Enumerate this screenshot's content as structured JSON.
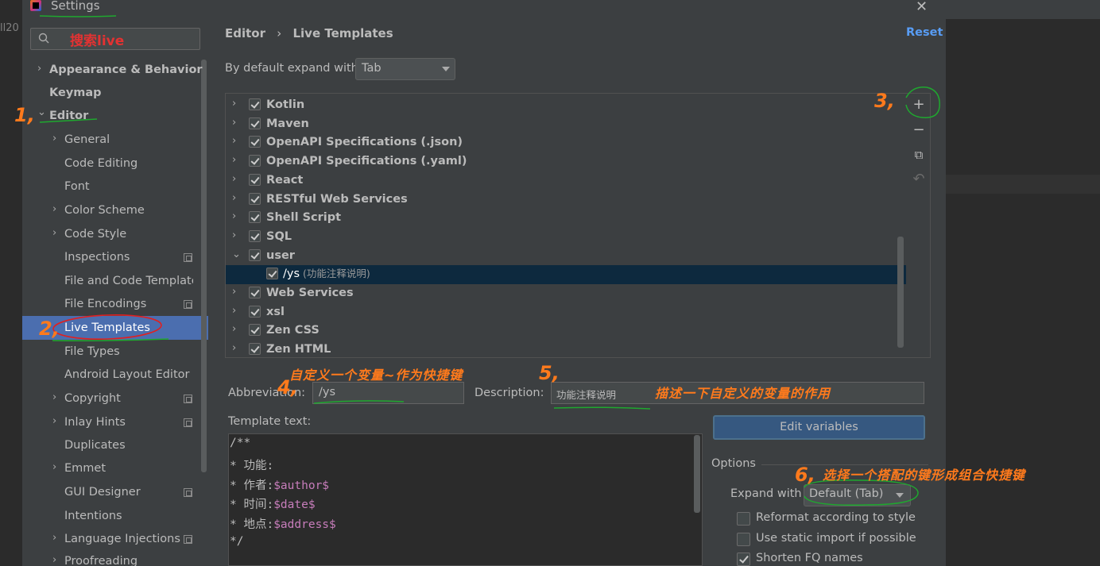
{
  "window": {
    "title": "Settings",
    "close_glyph": "✕",
    "bg_editor_text": "ll20"
  },
  "search": {
    "value": "搜索live"
  },
  "sidebar": {
    "items": [
      {
        "label": "Appearance & Behavior",
        "chevron": "›"
      },
      {
        "label": "Keymap"
      },
      {
        "label": "Editor",
        "chevron": "⌄"
      },
      {
        "label": "General",
        "chevron": "›"
      },
      {
        "label": "Code Editing"
      },
      {
        "label": "Font"
      },
      {
        "label": "Color Scheme",
        "chevron": "›"
      },
      {
        "label": "Code Style",
        "chevron": "›"
      },
      {
        "label": "Inspections"
      },
      {
        "label": "File and Code Templates"
      },
      {
        "label": "File Encodings"
      },
      {
        "label": "Live Templates"
      },
      {
        "label": "File Types"
      },
      {
        "label": "Android Layout Editor"
      },
      {
        "label": "Copyright",
        "chevron": "›"
      },
      {
        "label": "Inlay Hints",
        "chevron": "›"
      },
      {
        "label": "Duplicates"
      },
      {
        "label": "Emmet",
        "chevron": "›"
      },
      {
        "label": "GUI Designer"
      },
      {
        "label": "Intentions"
      },
      {
        "label": "Language Injections",
        "chevron": "›"
      },
      {
        "label": "Proofreading",
        "chevron": "›"
      }
    ]
  },
  "header": {
    "breadcrumb_parent": "Editor",
    "breadcrumb_sep": "›",
    "breadcrumb_current": "Live Templates",
    "reset_label": "Reset"
  },
  "expand_default": {
    "label": "By default expand with",
    "value": "Tab"
  },
  "template_groups": [
    {
      "name": "Kotlin"
    },
    {
      "name": "Maven"
    },
    {
      "name": "OpenAPI Specifications (.json)"
    },
    {
      "name": "OpenAPI Specifications (.yaml)"
    },
    {
      "name": "React"
    },
    {
      "name": "RESTful Web Services"
    },
    {
      "name": "Shell Script"
    },
    {
      "name": "SQL"
    },
    {
      "name": "user"
    },
    {
      "name": "/ys",
      "desc": "(功能注释说明)"
    },
    {
      "name": "Web Services"
    },
    {
      "name": "xsl"
    },
    {
      "name": "Zen CSS"
    },
    {
      "name": "Zen HTML"
    }
  ],
  "toolbar": {
    "add": "+",
    "remove": "−",
    "copy": "⧉",
    "revert": "↶"
  },
  "fields": {
    "abbreviation_label": "Abbreviation:",
    "abbreviation_value": "/ys",
    "description_label": "Description:",
    "description_value": "功能注释说明",
    "template_text_label": "Template text:",
    "edit_variables_label": "Edit variables"
  },
  "template_code": [
    {
      "text": "/**",
      "var": ""
    },
    {
      "text": "* 功能:",
      "var": ""
    },
    {
      "text": "* 作者:",
      "var": "$author$"
    },
    {
      "text": "* 时间:",
      "var": "$date$"
    },
    {
      "text": "* 地点:",
      "var": "$address$"
    },
    {
      "text": "*/",
      "var": ""
    }
  ],
  "options": {
    "label": "Options",
    "expand_with_label": "Expand with",
    "expand_with_value": "Default (Tab)",
    "checks": [
      {
        "label": "Reformat according to style",
        "checked": false
      },
      {
        "label": "Use static import if possible",
        "checked": false
      },
      {
        "label": "Shorten FQ names",
        "checked": true
      }
    ]
  },
  "annotations": {
    "n1": "1,",
    "n2": "2,",
    "n3": "3,",
    "n4": "4,",
    "n5": "5,",
    "n6": "6,",
    "a4": "自定义一个变量~作为快捷键",
    "a5": "描述一下自定义的变量的作用",
    "a6": "选择一个搭配的键形成组合快捷键",
    "color": "#ff7a1c"
  },
  "colors": {
    "selection": "#4b6eaf",
    "link": "#589df6",
    "template_var": "#c77dbb",
    "annotation_circle_red": "#e02020",
    "annotation_circle_green": "#1fa82f"
  }
}
